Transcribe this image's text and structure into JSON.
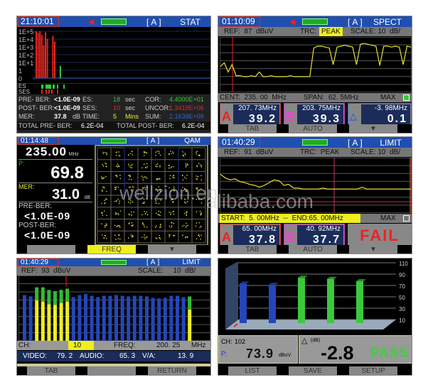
{
  "stat": {
    "time": "21:10:01",
    "mode": "[A]",
    "title": "STAT",
    "yticks": [
      "1E+5",
      "1E+4",
      "1E+3",
      "1E+2",
      "1E+1",
      "1",
      "0"
    ],
    "es": "ES",
    "ses": "SES",
    "rows": [
      [
        "PRE- BER:",
        "<1.0E-09",
        "ES:",
        "18",
        "sec",
        "COR:",
        "4.4000E+01"
      ],
      [
        "POST- BER:",
        "<1.0E-09",
        "SES:",
        "10",
        "sec",
        "UNCOR:",
        "1.3419E+06"
      ],
      [
        "MER:",
        "37.8",
        "TIME:",
        "5",
        "Mins",
        "SUM:",
        "2.1638E+09"
      ]
    ],
    "mer_unit": "dB",
    "total_pre_label": "TOTAL  PRE- BER:",
    "total_pre": "6.2E-04",
    "total_post_label": "TOTAL  POST- BER:",
    "total_post": "6.2E-04"
  },
  "spect": {
    "time": "01:10:09",
    "mode": "[A]",
    "title": "SPECT",
    "ref": "REF:  87  dBuV",
    "trc": "TRC:",
    "trc_val": "PEAK",
    "scale": "SCALE: 10  dB/",
    "cent": "CENT:  235. 00  MHz",
    "span": "SPAN:  62. 5MHz",
    "max": "MAX",
    "a_label": "A",
    "a_freq": "207. 73MHz",
    "a_val": "39.2",
    "b_label": "B",
    "b_freq": "203. 75MHz",
    "b_val": "39.3",
    "d_freq": "-3. 98MHz",
    "d_val": "0.1",
    "btn1": "TAB",
    "btn2": "AUTO"
  },
  "qam": {
    "time": "01:14:48",
    "mode": "[A]",
    "title": "QAM",
    "freq": "235.00",
    "freq_unit": "MHz",
    "p_label": "P:",
    "p_val": "69.8",
    "mer_label": "MER:",
    "mer_val": "31.0",
    "mer_unit": "dB",
    "pre_label": "PRE-BER:",
    "pre_val": "<1.0E-09",
    "post_label": "POST-BER:",
    "post_val": "<1.0E-09",
    "btn2": "FREQ"
  },
  "limit": {
    "time": "01:40:29",
    "mode": "[A]",
    "title": "LIMIT",
    "ref": "REF:  91  dBuV",
    "trc": "TRC:  PEAK",
    "scale": "SCALE: 10  dB/",
    "range": "START:  5. 00MHz  --  END:65. 00MHz",
    "max": "MAX",
    "a_label": "A",
    "a_freq": "65. 00MHz",
    "a_val": "37.8",
    "b_label": "B",
    "b_freq": "40. 92MHz",
    "b_val": "37.7",
    "result": "FAIL",
    "btn1": "TAB",
    "btn2": "AUTO"
  },
  "tilt": {
    "time": "01:40:29",
    "mode": "[A]",
    "title": "LIMIT",
    "ref": "REF:  93  dBuV",
    "scale": "SCALE:     10  dB/",
    "ch_label": "CH:",
    "ch": "10",
    "freq_label": "FREQ:",
    "freq": "200. 25",
    "freq_unit": "MHz",
    "video_label": "VIDEO:",
    "video": "79. 2",
    "audio_label": "AUDIO:",
    "audio": "65. 3",
    "va_label": "V/A:",
    "va": "13. 9",
    "btn1": "TAB",
    "btn3": "RETURN"
  },
  "scan": {
    "yticks": [
      "110",
      "90",
      "70",
      "50",
      "30",
      "10"
    ],
    "ch_label": "CH:",
    "ch": "102",
    "p_label": "P:",
    "p_val": "73.9",
    "p_unit": "dBuV",
    "delta_label": "(dB)",
    "delta": "-2.8",
    "result": "PASS",
    "btn1": "LIST",
    "btn2": "SAVE",
    "btn3": "SETUP"
  },
  "watermarks": [
    "wellzion.en",
    "alibaba.com"
  ],
  "chart_data": [
    {
      "type": "bar",
      "title": "STAT error histogram",
      "series": [
        {
          "name": "errors",
          "color": "#e8261c",
          "values": [
            5,
            4.8,
            5,
            4.6,
            3.5,
            4.9,
            4.2,
            0,
            0,
            4.5,
            3.9,
            0,
            0,
            1.3
          ]
        }
      ],
      "ylim": [
        0,
        5
      ]
    },
    {
      "type": "line",
      "title": "SPECT",
      "ylabel": "dBuV",
      "xlim": [
        203.75,
        266.25
      ],
      "values": [
        28,
        32,
        22,
        30,
        18,
        18,
        17,
        17,
        18,
        17,
        22,
        17,
        17,
        18,
        17,
        17,
        17,
        17,
        18,
        17,
        17,
        17,
        17,
        17,
        48,
        50,
        50,
        49,
        48,
        30,
        49,
        50,
        51,
        50,
        49,
        30,
        52,
        53,
        52,
        51,
        50,
        29,
        50,
        50,
        49,
        50,
        49,
        30,
        50,
        49
      ]
    },
    {
      "type": "line",
      "title": "LIMIT",
      "xlim": [
        5,
        65
      ],
      "values": [
        42,
        38,
        36,
        37,
        34,
        33,
        31,
        30,
        28,
        30,
        33,
        36,
        35,
        30,
        31,
        27,
        27,
        26,
        26,
        26,
        26,
        27,
        26,
        26,
        26,
        26,
        26,
        26,
        26,
        28,
        26,
        26,
        26,
        26,
        26,
        26,
        26,
        26,
        26,
        26
      ]
    },
    {
      "type": "bar",
      "title": "TILT",
      "ylim": [
        0,
        100
      ],
      "values": [
        70,
        68,
        82,
        82,
        78,
        76,
        78,
        80,
        67,
        70,
        72,
        69,
        67,
        69,
        69,
        70,
        69,
        68,
        69,
        69,
        68,
        66,
        65,
        66,
        69,
        69,
        67,
        68
      ],
      "video_portion": [
        0,
        0,
        62,
        60,
        56,
        55,
        58,
        60,
        0,
        0,
        0,
        0,
        0,
        0,
        0,
        0,
        0,
        0,
        0,
        0,
        0,
        0,
        0,
        0,
        0,
        0,
        0,
        48
      ]
    },
    {
      "type": "bar",
      "title": "SCAN",
      "ylim": [
        0,
        110
      ],
      "values": [
        68,
        66,
        78,
        76,
        72
      ],
      "colors": [
        "#2446b8",
        "#2446b8",
        "#3cc83c",
        "#3cc83c",
        "#3cc83c"
      ]
    }
  ]
}
